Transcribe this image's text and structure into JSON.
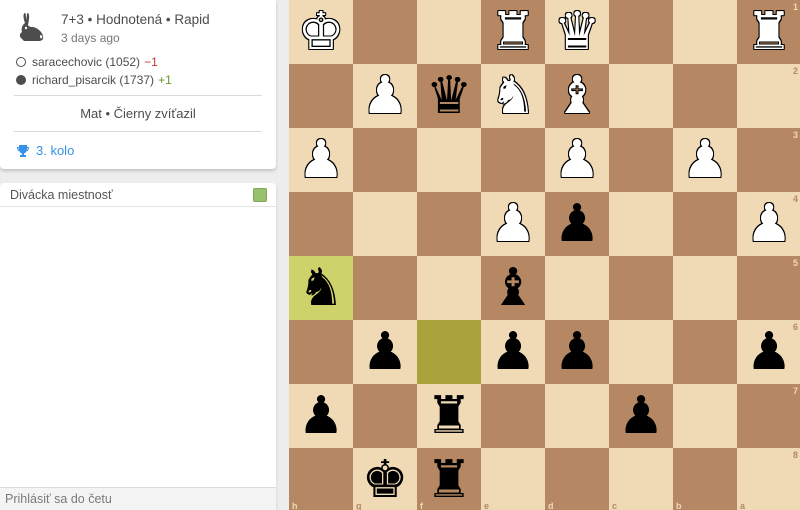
{
  "game": {
    "setup": "7+3 • Hodnotená • Rapid",
    "date": "3 days ago",
    "players": [
      {
        "name": "saracechovic (1052)",
        "diff": "−1",
        "diff_color": "#cc3333",
        "side": "white"
      },
      {
        "name": "richard_pisarcik (1737)",
        "diff": "+1",
        "diff_color": "#629924",
        "side": "black"
      }
    ],
    "result": "Mat • Čierny zvíťazil",
    "round": "3. kolo"
  },
  "chat": {
    "title": "Divácka miestnosť",
    "placeholder": "Prihlásiť sa do četu"
  },
  "board": {
    "orientation": "black",
    "rank_labels": [
      "1",
      "2",
      "3",
      "4",
      "5",
      "6",
      "7",
      "8"
    ],
    "file_labels": [
      "h",
      "g",
      "f",
      "e",
      "d",
      "c",
      "b",
      "a"
    ],
    "colors": {
      "light": "#f0d9b5",
      "dark": "#b58863",
      "last_move": "#aaa23a",
      "last_move_piece": "#cdd26a"
    },
    "highlights": [
      {
        "square": "f6",
        "kind": "last_move"
      },
      {
        "square": "h5",
        "kind": "last_move_piece"
      }
    ],
    "pieces": [
      {
        "square": "h1",
        "piece": "K",
        "color": "w"
      },
      {
        "square": "e1",
        "piece": "R",
        "color": "w"
      },
      {
        "square": "d1",
        "piece": "Q",
        "color": "w"
      },
      {
        "square": "a1",
        "piece": "R",
        "color": "w"
      },
      {
        "square": "g2",
        "piece": "P",
        "color": "w"
      },
      {
        "square": "f2",
        "piece": "Q",
        "color": "b"
      },
      {
        "square": "e2",
        "piece": "N",
        "color": "w"
      },
      {
        "square": "d2",
        "piece": "B",
        "color": "w"
      },
      {
        "square": "h3",
        "piece": "P",
        "color": "w"
      },
      {
        "square": "d3",
        "piece": "P",
        "color": "w"
      },
      {
        "square": "b3",
        "piece": "P",
        "color": "w"
      },
      {
        "square": "e4",
        "piece": "P",
        "color": "w"
      },
      {
        "square": "d4",
        "piece": "P",
        "color": "b"
      },
      {
        "square": "a4",
        "piece": "P",
        "color": "w"
      },
      {
        "square": "h5",
        "piece": "N",
        "color": "b"
      },
      {
        "square": "e5",
        "piece": "B",
        "color": "b"
      },
      {
        "square": "g6",
        "piece": "P",
        "color": "b"
      },
      {
        "square": "e6",
        "piece": "P",
        "color": "b"
      },
      {
        "square": "d6",
        "piece": "P",
        "color": "b"
      },
      {
        "square": "a6",
        "piece": "P",
        "color": "b"
      },
      {
        "square": "h7",
        "piece": "P",
        "color": "b"
      },
      {
        "square": "f7",
        "piece": "R",
        "color": "b"
      },
      {
        "square": "c7",
        "piece": "P",
        "color": "b"
      },
      {
        "square": "g8",
        "piece": "K",
        "color": "b"
      },
      {
        "square": "f8",
        "piece": "R",
        "color": "b"
      }
    ]
  },
  "icons": {
    "variant": "rabbit-icon",
    "round": "trophy-icon",
    "chat_toggle": "toggle-checkbox"
  }
}
